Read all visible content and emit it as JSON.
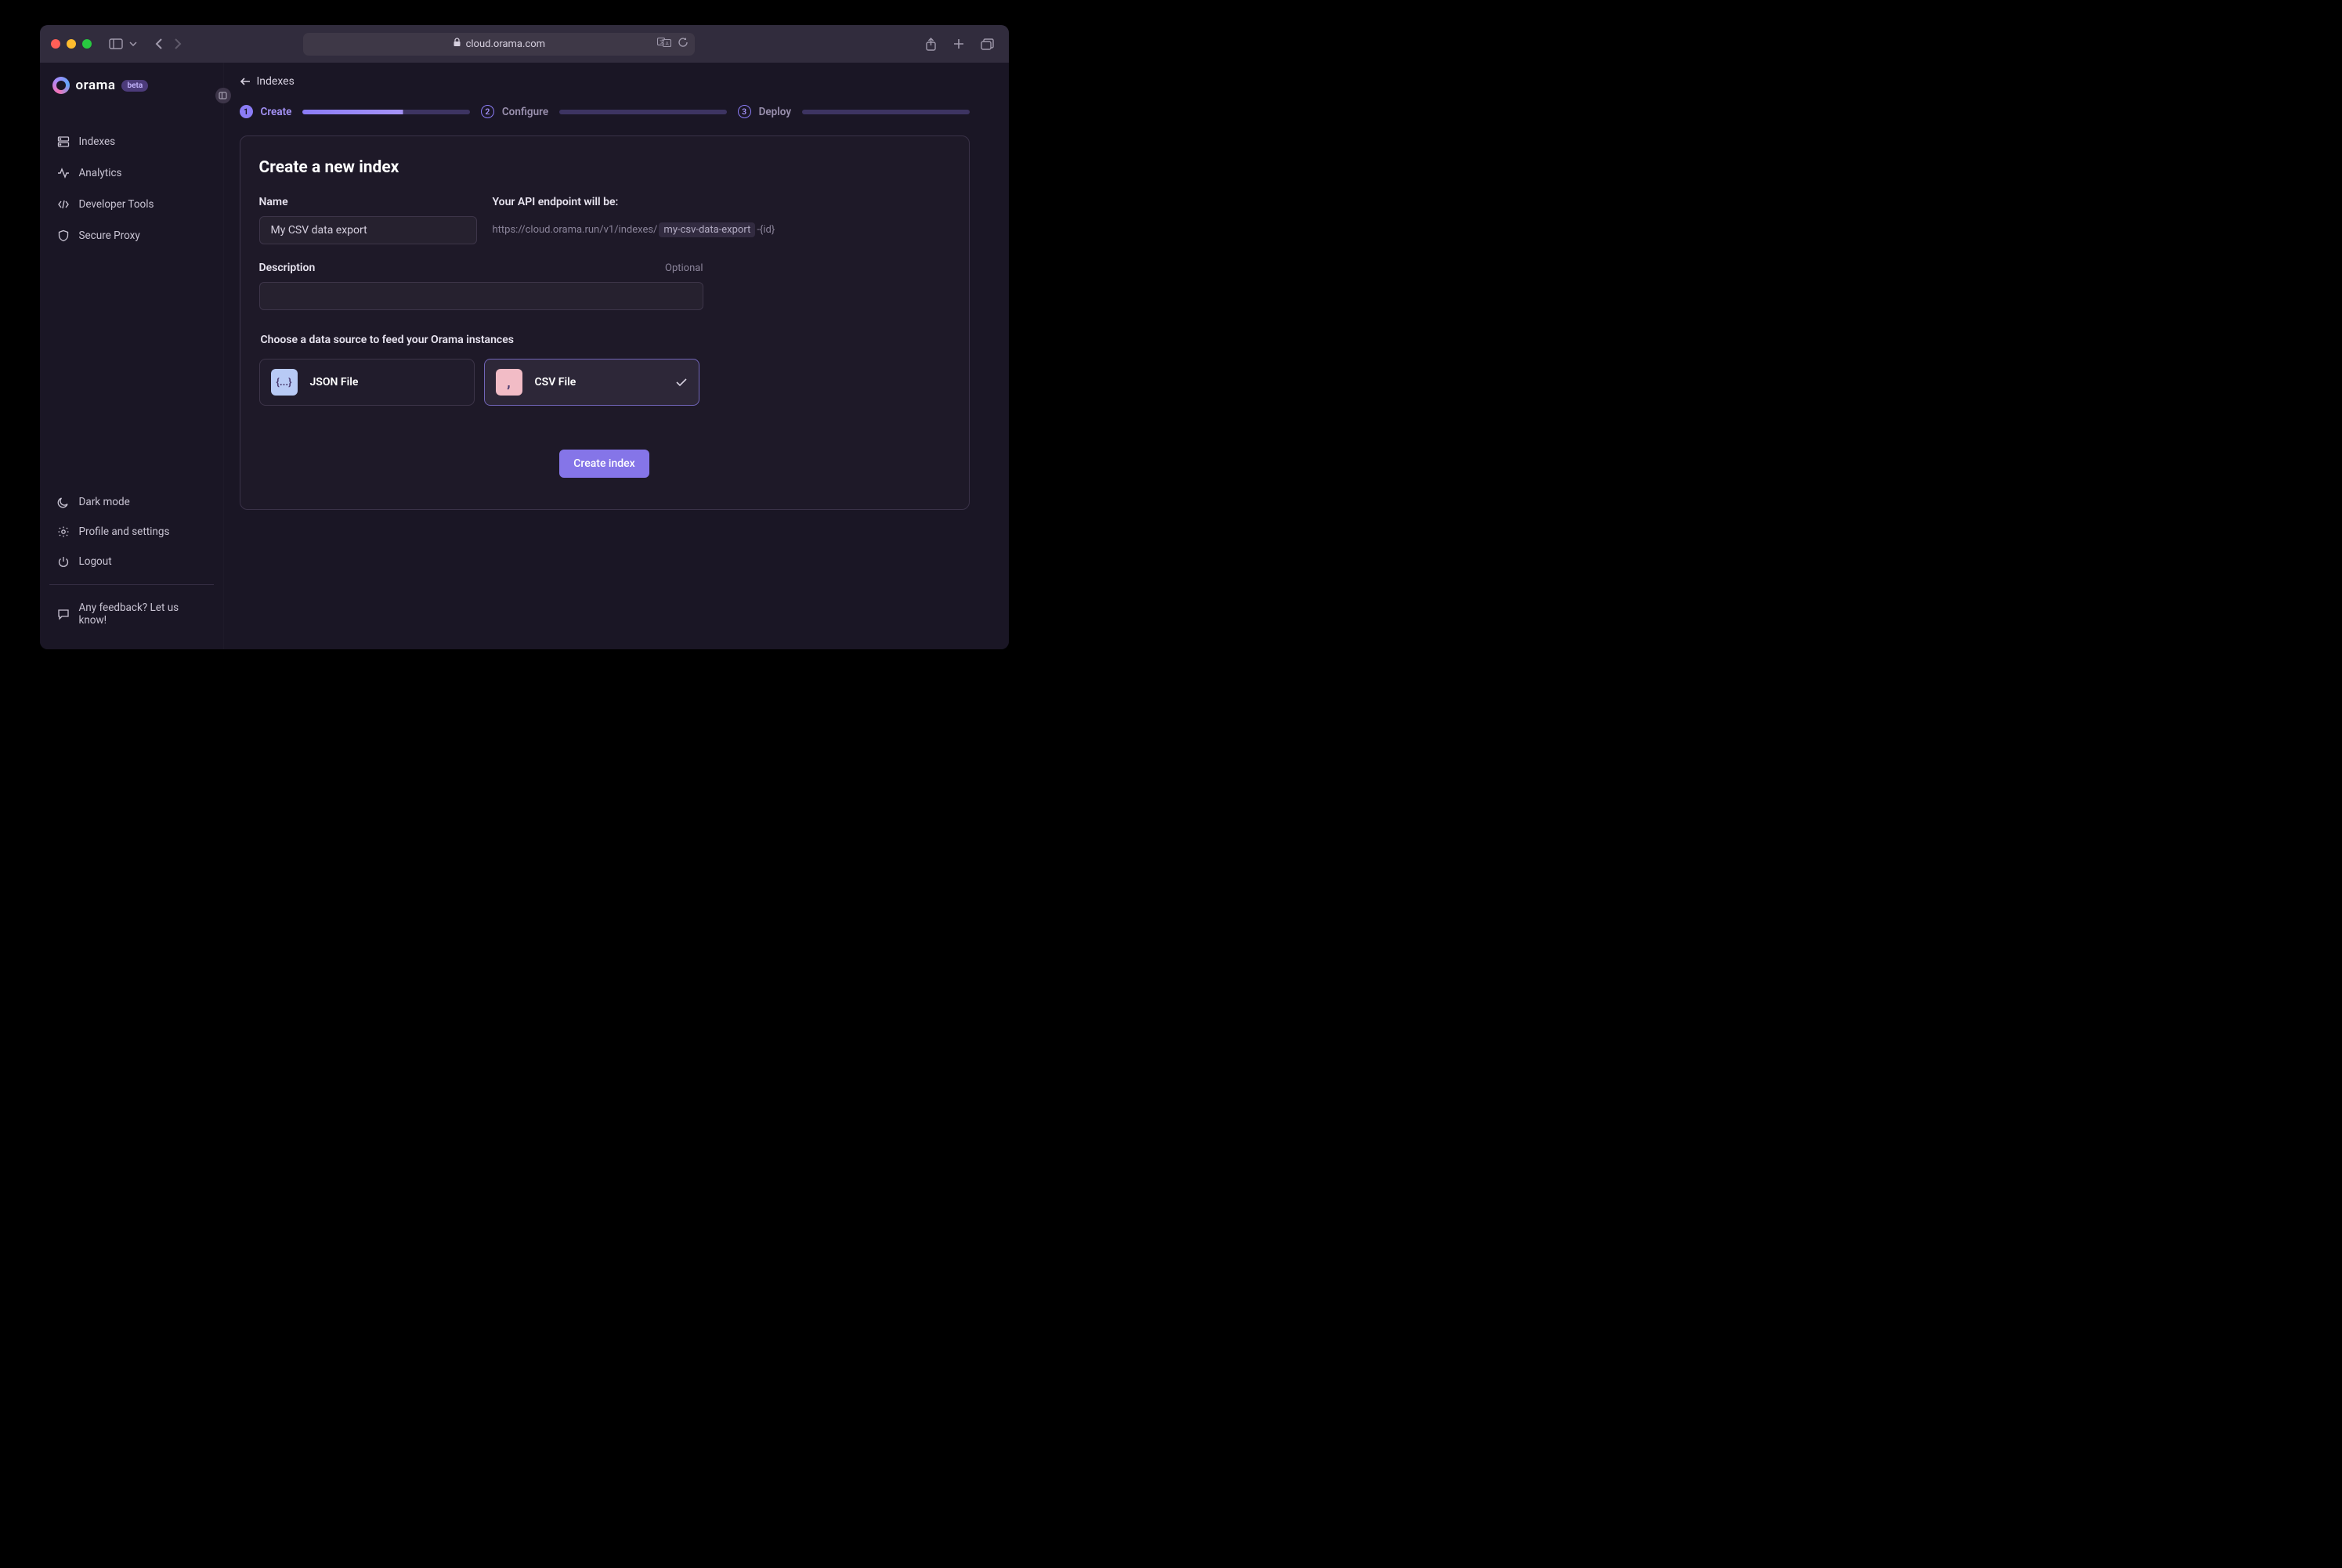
{
  "browser": {
    "url": "cloud.orama.com"
  },
  "logo": {
    "text": "orama",
    "badge": "beta"
  },
  "sidebar": {
    "main": [
      {
        "label": "Indexes"
      },
      {
        "label": "Analytics"
      },
      {
        "label": "Developer Tools"
      },
      {
        "label": "Secure Proxy"
      }
    ],
    "bottom": [
      {
        "label": "Dark mode"
      },
      {
        "label": "Profile and settings"
      },
      {
        "label": "Logout"
      }
    ],
    "feedback": "Any feedback? Let us know!"
  },
  "back": {
    "label": "Indexes"
  },
  "stepper": {
    "steps": [
      {
        "num": "1",
        "label": "Create"
      },
      {
        "num": "2",
        "label": "Configure"
      },
      {
        "num": "3",
        "label": "Deploy"
      }
    ]
  },
  "form": {
    "title": "Create a new index",
    "name_label": "Name",
    "name_value": "My CSV data export",
    "endpoint_label": "Your API endpoint will be:",
    "endpoint_prefix": "https://cloud.orama.run/v1/indexes/",
    "endpoint_slug": "my-csv-data-export",
    "endpoint_suffix": "-{id}",
    "desc_label": "Description",
    "desc_optional": "Optional",
    "desc_value": "",
    "source_label": "Choose a data source to feed your Orama instances",
    "sources": [
      {
        "name": "JSON File",
        "icon_text": "{...}",
        "selected": false
      },
      {
        "name": "CSV File",
        "icon_text": ",",
        "selected": true
      }
    ],
    "submit_label": "Create index"
  }
}
